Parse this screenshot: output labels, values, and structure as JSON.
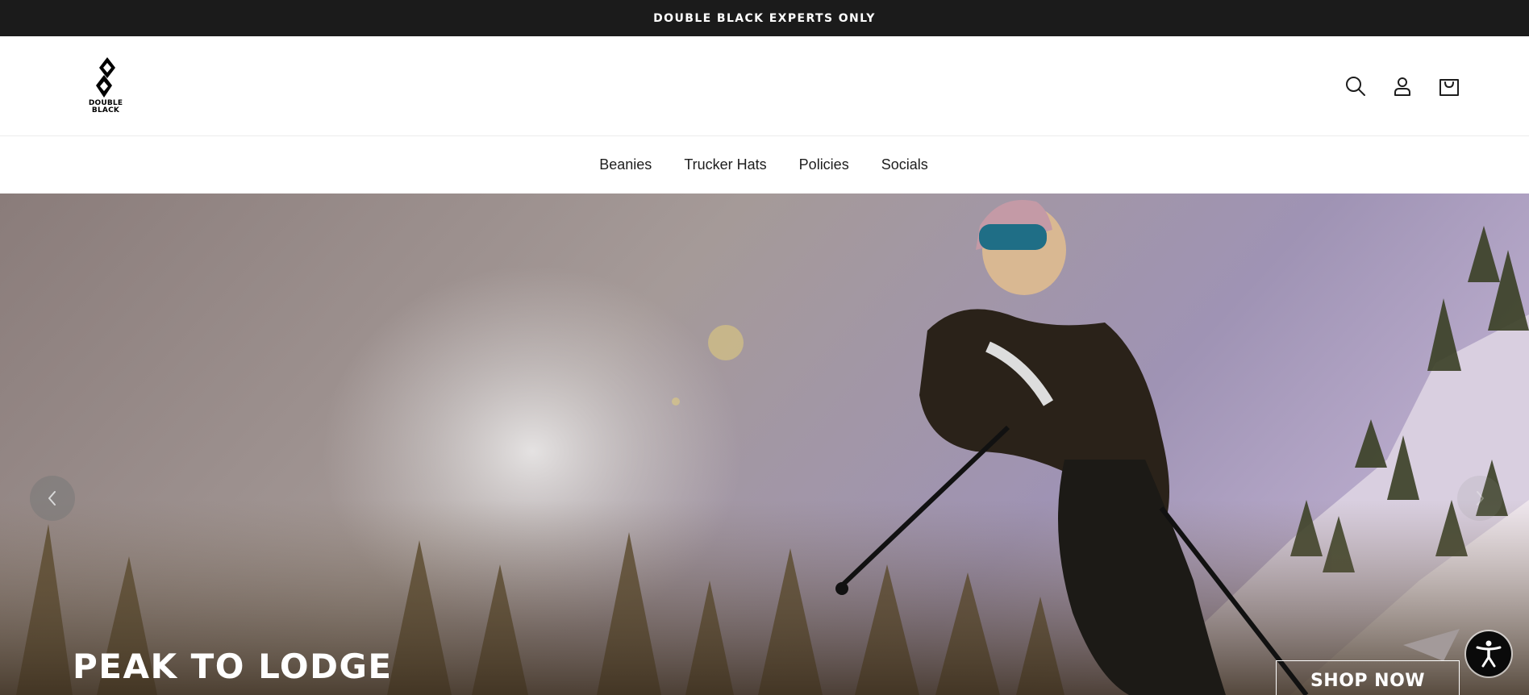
{
  "announcement": {
    "text": "DOUBLE BLACK EXPERTS ONLY"
  },
  "header": {
    "logo_text_line1": "DOUBLE",
    "logo_text_line2": "BLACK",
    "icons": [
      "search-icon",
      "account-icon",
      "cart-icon"
    ]
  },
  "nav": {
    "items": [
      {
        "label": "Beanies"
      },
      {
        "label": "Trucker Hats"
      },
      {
        "label": "Policies"
      },
      {
        "label": "Socials"
      }
    ]
  },
  "hero": {
    "heading": "PEAK TO LODGE",
    "cta_label": "SHOP NOW",
    "prev_icon": "chevron-left-icon",
    "next_icon": "chevron-right-icon"
  },
  "accessibility": {
    "icon": "accessibility-icon"
  },
  "colors": {
    "announcement_bg": "#1b1b1b",
    "text_dark": "#1d1d1d",
    "white": "#ffffff"
  }
}
